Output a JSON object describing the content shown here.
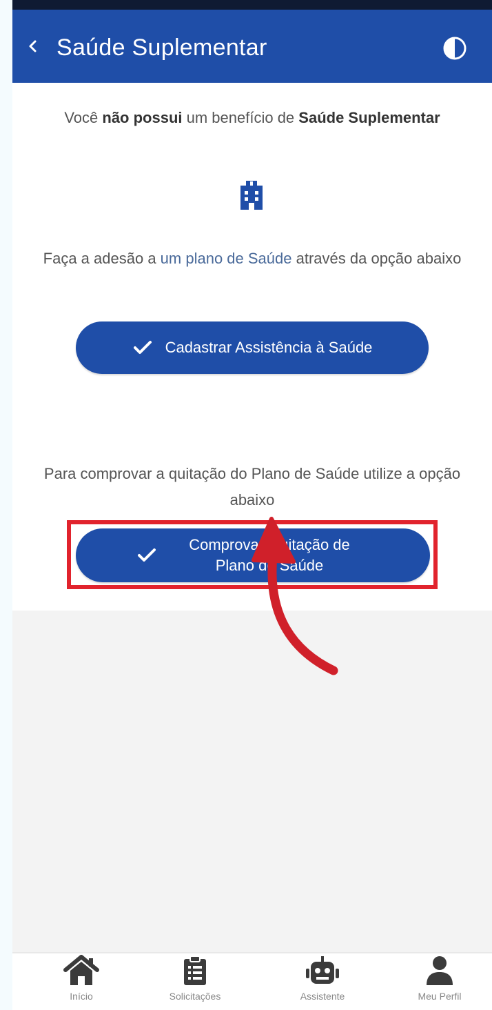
{
  "header": {
    "title": "Saúde Suplementar",
    "back_icon": "chevron-left-icon",
    "contrast_icon": "contrast-icon"
  },
  "notice": {
    "prefix": "Você ",
    "bold1": "não possui",
    "middle": " um benefício de ",
    "bold2": "Saúde Suplementar",
    "icon": "hospital-building-icon"
  },
  "adhesion": {
    "text_before": "Faça a adesão a ",
    "link": "um plano de Saúde",
    "text_after": " através da opção abaixo",
    "button_label": "Cadastrar Assistência à Saúde"
  },
  "payment_proof": {
    "text": "Para comprovar a quitação do Plano de Saúde utilize a opção abaixo",
    "button_label": "Comprovar Quitação de Plano de Saúde"
  },
  "tab_bar": {
    "items": [
      {
        "label": "Início",
        "icon": "home-icon"
      },
      {
        "label": "Solicitações",
        "icon": "clipboard-icon"
      },
      {
        "label": "Assistente",
        "icon": "robot-icon"
      },
      {
        "label": "Meu Perfil",
        "icon": "user-icon"
      }
    ]
  },
  "colors": {
    "primary": "#1f4ea8",
    "highlight": "#e1232d"
  }
}
